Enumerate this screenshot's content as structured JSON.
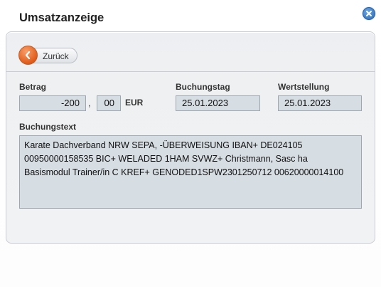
{
  "dialog": {
    "title": "Umsatzanzeige",
    "close_icon": "close-icon"
  },
  "toolbar": {
    "back_label": "Zurück",
    "back_icon": "chevron-left-icon",
    "accent_color": "#e05c1a"
  },
  "amount": {
    "label": "Betrag",
    "whole": "-200",
    "separator": ",",
    "cents": "00",
    "currency": "EUR"
  },
  "booking_date": {
    "label": "Buchungstag",
    "value": "25.01.2023"
  },
  "value_date": {
    "label": "Wertstellung",
    "value": "25.01.2023"
  },
  "booking_text": {
    "label": "Buchungstext",
    "lines": [
      "Karate Dachverband NRW SEPA, -ÜBERWEISUNG IBAN+ DE024105",
      "00950000158535 BIC+ WELADED 1HAM SVWZ+ Christmann, Sasc ha",
      "Basismodul Trainer/in C KREF+ GENODED1SPW2301250712 00620000014100"
    ]
  }
}
